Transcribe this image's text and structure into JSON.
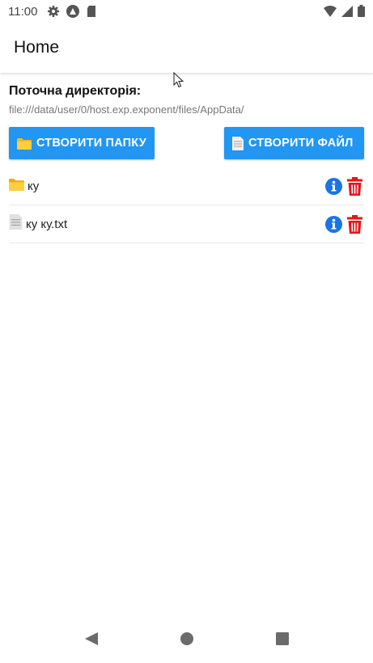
{
  "status_bar": {
    "time": "11:00",
    "icons": [
      "gear-icon",
      "react-icon",
      "sd-card-icon",
      "wifi-icon",
      "signal-icon",
      "battery-icon"
    ]
  },
  "app_bar": {
    "title": "Home"
  },
  "directory": {
    "label": "Поточна директорія:",
    "path": "file:///data/user/0/host.exp.exponent/files/AppData/"
  },
  "buttons": {
    "create_folder": "СТВОРИТИ ПАПКУ",
    "create_file": "СТВОРИТИ ФАЙЛ"
  },
  "items": [
    {
      "type": "folder",
      "name": "ку",
      "icon": "folder-icon"
    },
    {
      "type": "file",
      "name": "ку ку.txt",
      "icon": "file-icon"
    }
  ],
  "colors": {
    "accent": "#2196f3",
    "info": "#1a73e8",
    "delete": "#e8141b"
  },
  "nav": [
    "back-icon",
    "home-icon",
    "recents-icon"
  ]
}
